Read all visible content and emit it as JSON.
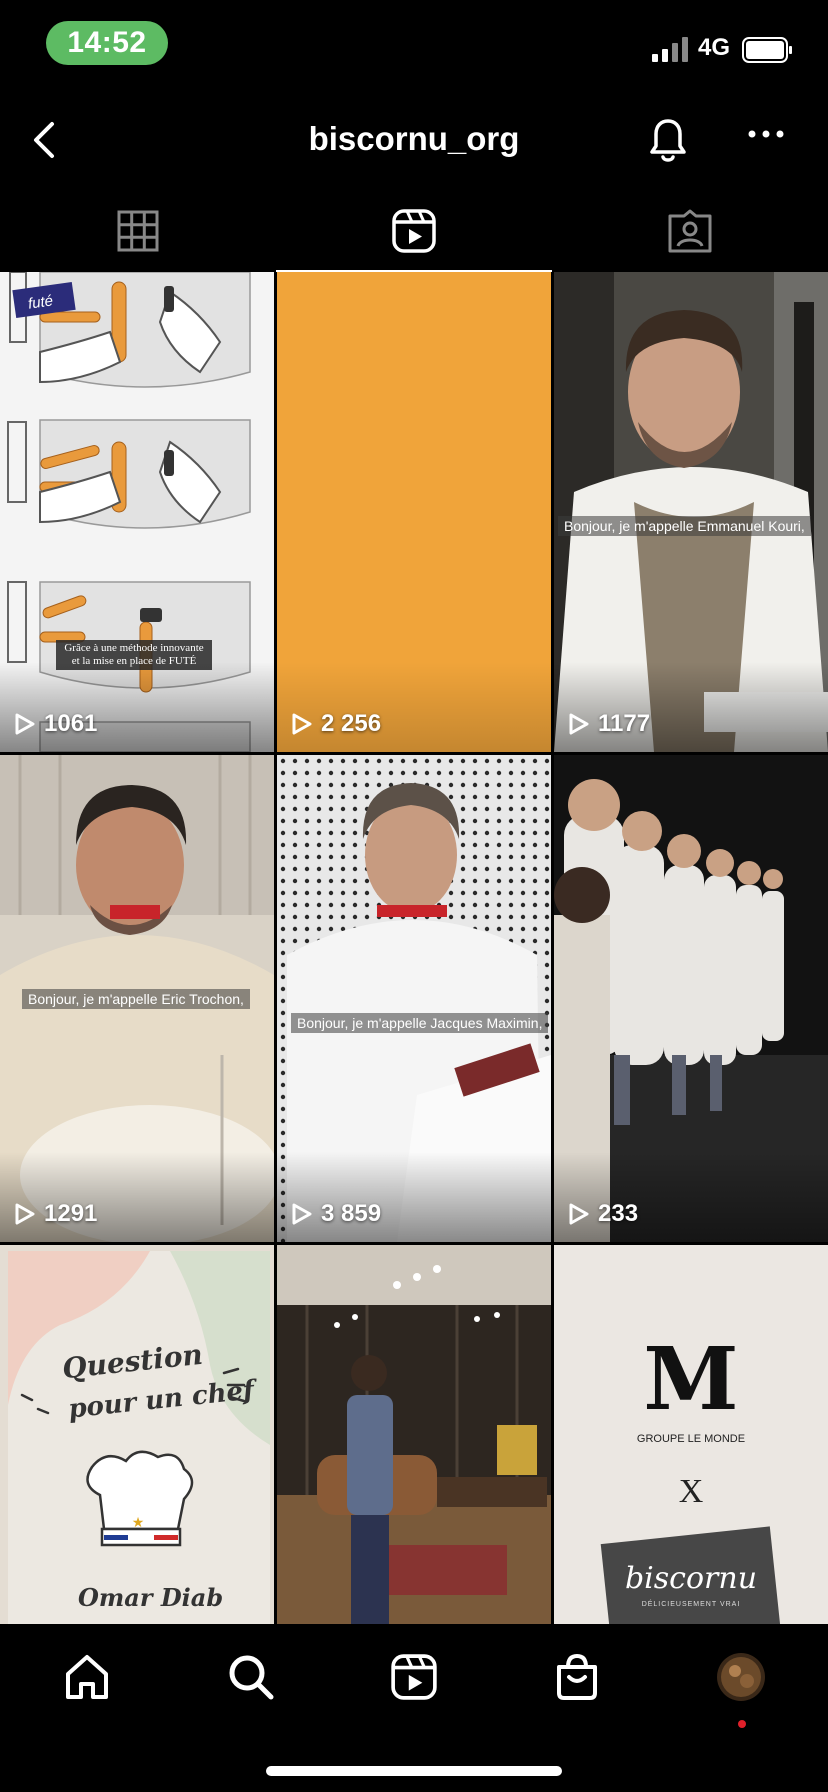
{
  "status_bar": {
    "time": "14:52",
    "network": "4G"
  },
  "header": {
    "username": "biscornu_org"
  },
  "tabs": [
    {
      "icon": "grid-icon",
      "active": false
    },
    {
      "icon": "reels-icon",
      "active": true
    },
    {
      "icon": "tagged-icon",
      "active": false
    }
  ],
  "reels": [
    {
      "views": "1061",
      "caption": "Grâce à une méthode innovante et la mise en place de FUTÉ",
      "badge": "futé"
    },
    {
      "views": "2 256",
      "color": "#f0a43a"
    },
    {
      "views": "1177",
      "caption": "Bonjour, je m'appelle Emmanuel Kouri,"
    },
    {
      "views": "1291",
      "caption": "Bonjour, je m'appelle Eric Trochon,"
    },
    {
      "views": "3 859",
      "caption": "Bonjour, je m'appelle Jacques Maximin,"
    },
    {
      "views": "233"
    },
    {
      "title_line1": "Question",
      "title_line2": "pour un chef",
      "name": "Omar Diab"
    },
    {},
    {
      "logo_letter": "M",
      "logo_text": "GROUPE LE MONDE",
      "separator": "X",
      "brand": "biscornu",
      "brand_tagline": "DÉLICIEUSEMENT VRAI"
    }
  ],
  "bottom_nav": [
    "home-icon",
    "search-icon",
    "reels-icon",
    "shop-icon",
    "profile-avatar"
  ],
  "colors": {
    "accent_orange": "#f0a43a",
    "status_green": "#5dbb63",
    "notification_red": "#e0202a"
  }
}
